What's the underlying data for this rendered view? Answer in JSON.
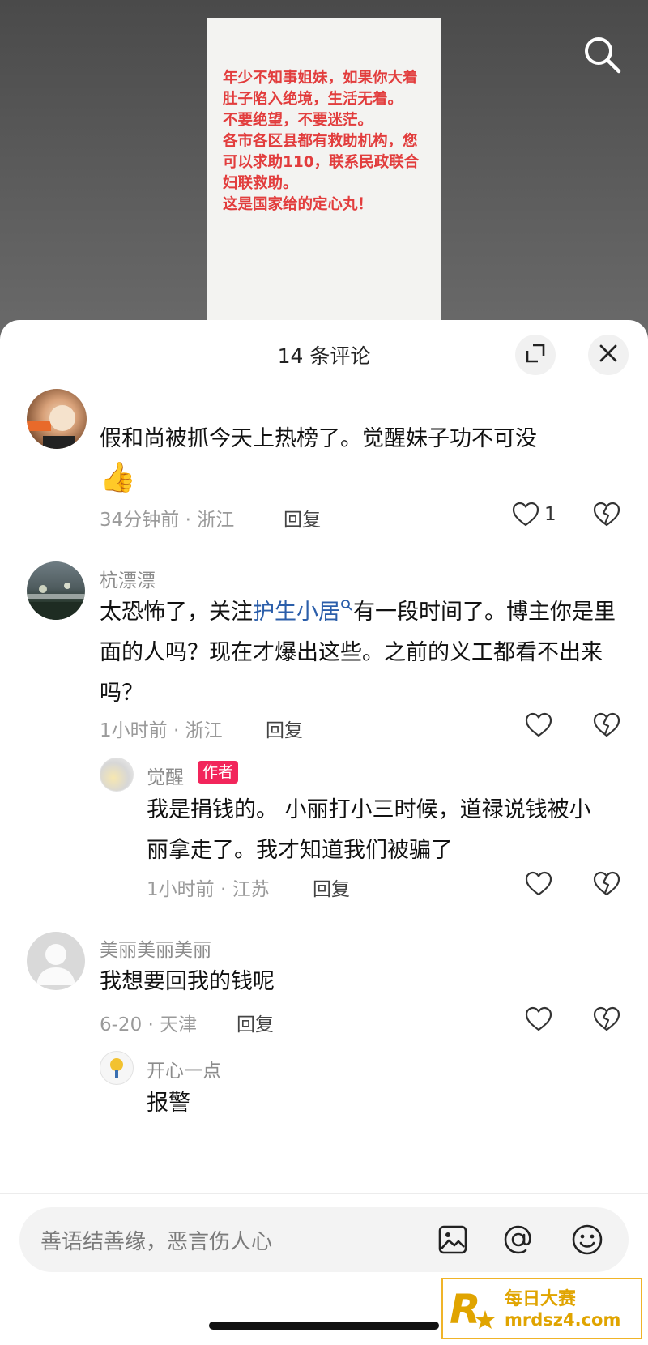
{
  "video": {
    "overlay_text": "年少不知事姐妹，如果你大着肚子陷入绝境，生活无着。\n不要绝望，不要迷茫。\n各市各区县都有救助机构，您可以求助110，联系民政联合妇联救助。\n这是国家给的定心丸！"
  },
  "sheet": {
    "title": "14 条评论"
  },
  "comments": [
    {
      "username": "",
      "text": "假和尚被抓今天上热榜了。觉醒妹子功不可没",
      "emoji": "👍",
      "time_location": "34分钟前 · 浙江",
      "reply_label": "回复",
      "like_count": "1"
    },
    {
      "username": "杭漂漂",
      "text_before": "太恐怖了，关注",
      "link": "护生小居",
      "text_after": "有一段时间了。博主你是里面的人吗？现在才爆出这些。之前的义工都看不出来吗？",
      "time_location": "1小时前 · 浙江",
      "reply_label": "回复",
      "reply": {
        "username": "觉醒",
        "tag": "作者",
        "text": "我是捐钱的。 小丽打小三时候，道禄说钱被小丽拿走了。我才知道我们被骗了",
        "time_location": "1小时前 · 江苏",
        "reply_label": "回复"
      }
    },
    {
      "username": "美丽美丽美丽",
      "text": "我想要回我的钱呢",
      "time_location": "6-20 · 天津",
      "reply_label": "回复",
      "reply": {
        "username": "开心一点",
        "text": "报警"
      }
    }
  ],
  "input": {
    "placeholder": "善语结善缘，恶言伤人心"
  },
  "watermark": {
    "line1": "每日大赛",
    "line2": "mrdsz4.com"
  },
  "colors": {
    "accent_red": "#e23d3d",
    "author_tag": "#f2255b",
    "link_blue": "#2b5eaa",
    "watermark_gold": "#e0a400"
  }
}
